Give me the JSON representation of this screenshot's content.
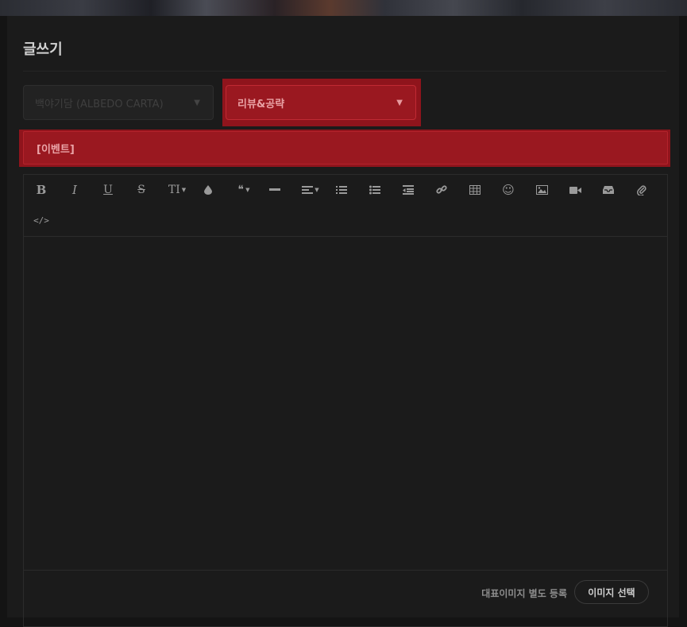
{
  "page": {
    "title": "글쓰기"
  },
  "form": {
    "board_select": {
      "value": "백야기담 (ALBEDO CARTA)"
    },
    "category_select": {
      "value": "리뷰&공략"
    },
    "title_input": {
      "value": "[이벤트]"
    }
  },
  "toolbar": {
    "buttons": [
      {
        "name": "bold",
        "glyph": "B"
      },
      {
        "name": "italic",
        "glyph": "I"
      },
      {
        "name": "underline",
        "glyph": "U"
      },
      {
        "name": "strikethrough",
        "glyph": "S"
      },
      {
        "name": "font-size",
        "glyph": "TI"
      },
      {
        "name": "color",
        "glyph": ""
      },
      {
        "name": "quote",
        "glyph": "❝"
      },
      {
        "name": "horizontal-rule",
        "glyph": ""
      },
      {
        "name": "align",
        "glyph": ""
      },
      {
        "name": "ordered-list",
        "glyph": ""
      },
      {
        "name": "unordered-list",
        "glyph": ""
      },
      {
        "name": "indent",
        "glyph": ""
      },
      {
        "name": "link",
        "glyph": ""
      },
      {
        "name": "table",
        "glyph": ""
      },
      {
        "name": "emoji",
        "glyph": "☺"
      },
      {
        "name": "image",
        "glyph": ""
      },
      {
        "name": "video",
        "glyph": ""
      },
      {
        "name": "inbox",
        "glyph": ""
      },
      {
        "name": "attachment",
        "glyph": ""
      },
      {
        "name": "code-view",
        "glyph": "</>"
      }
    ]
  },
  "footer": {
    "representative_image_label": "대표이미지 별도 등록",
    "select_image_button": "이미지 선택"
  },
  "colors": {
    "background": "#141414",
    "panel": "#1b1b1b",
    "highlight_red": "#9a1820"
  }
}
